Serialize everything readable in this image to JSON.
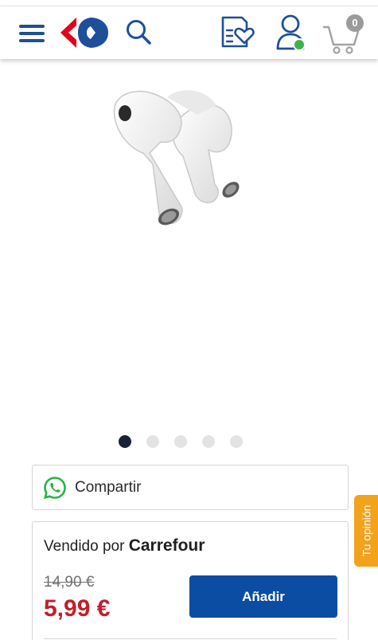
{
  "header": {
    "icons": [
      "menu-icon",
      "carrefour-logo",
      "search-icon",
      "shopping-list-icon",
      "account-icon",
      "cart-icon"
    ],
    "cart_count": "0",
    "colors": {
      "brand_blue": "#1d4f9a",
      "brand_red": "#e2001a",
      "online_dot": "#3cb34a"
    }
  },
  "gallery": {
    "image": "wireless-earbuds",
    "active_index": 0,
    "total": 5
  },
  "share": {
    "icon": "whatsapp-icon",
    "label": "Compartir"
  },
  "seller": {
    "prefix": "Vendido por",
    "name": "Carrefour"
  },
  "pricing": {
    "old_price": "14,90 €",
    "price": "5,99 €",
    "add_label": "Añadir",
    "colors": {
      "price_red": "#c0202c",
      "button_blue": "#0b4da2"
    }
  },
  "feedback": {
    "label": "Tu opinión",
    "color": "#f3a21c"
  }
}
